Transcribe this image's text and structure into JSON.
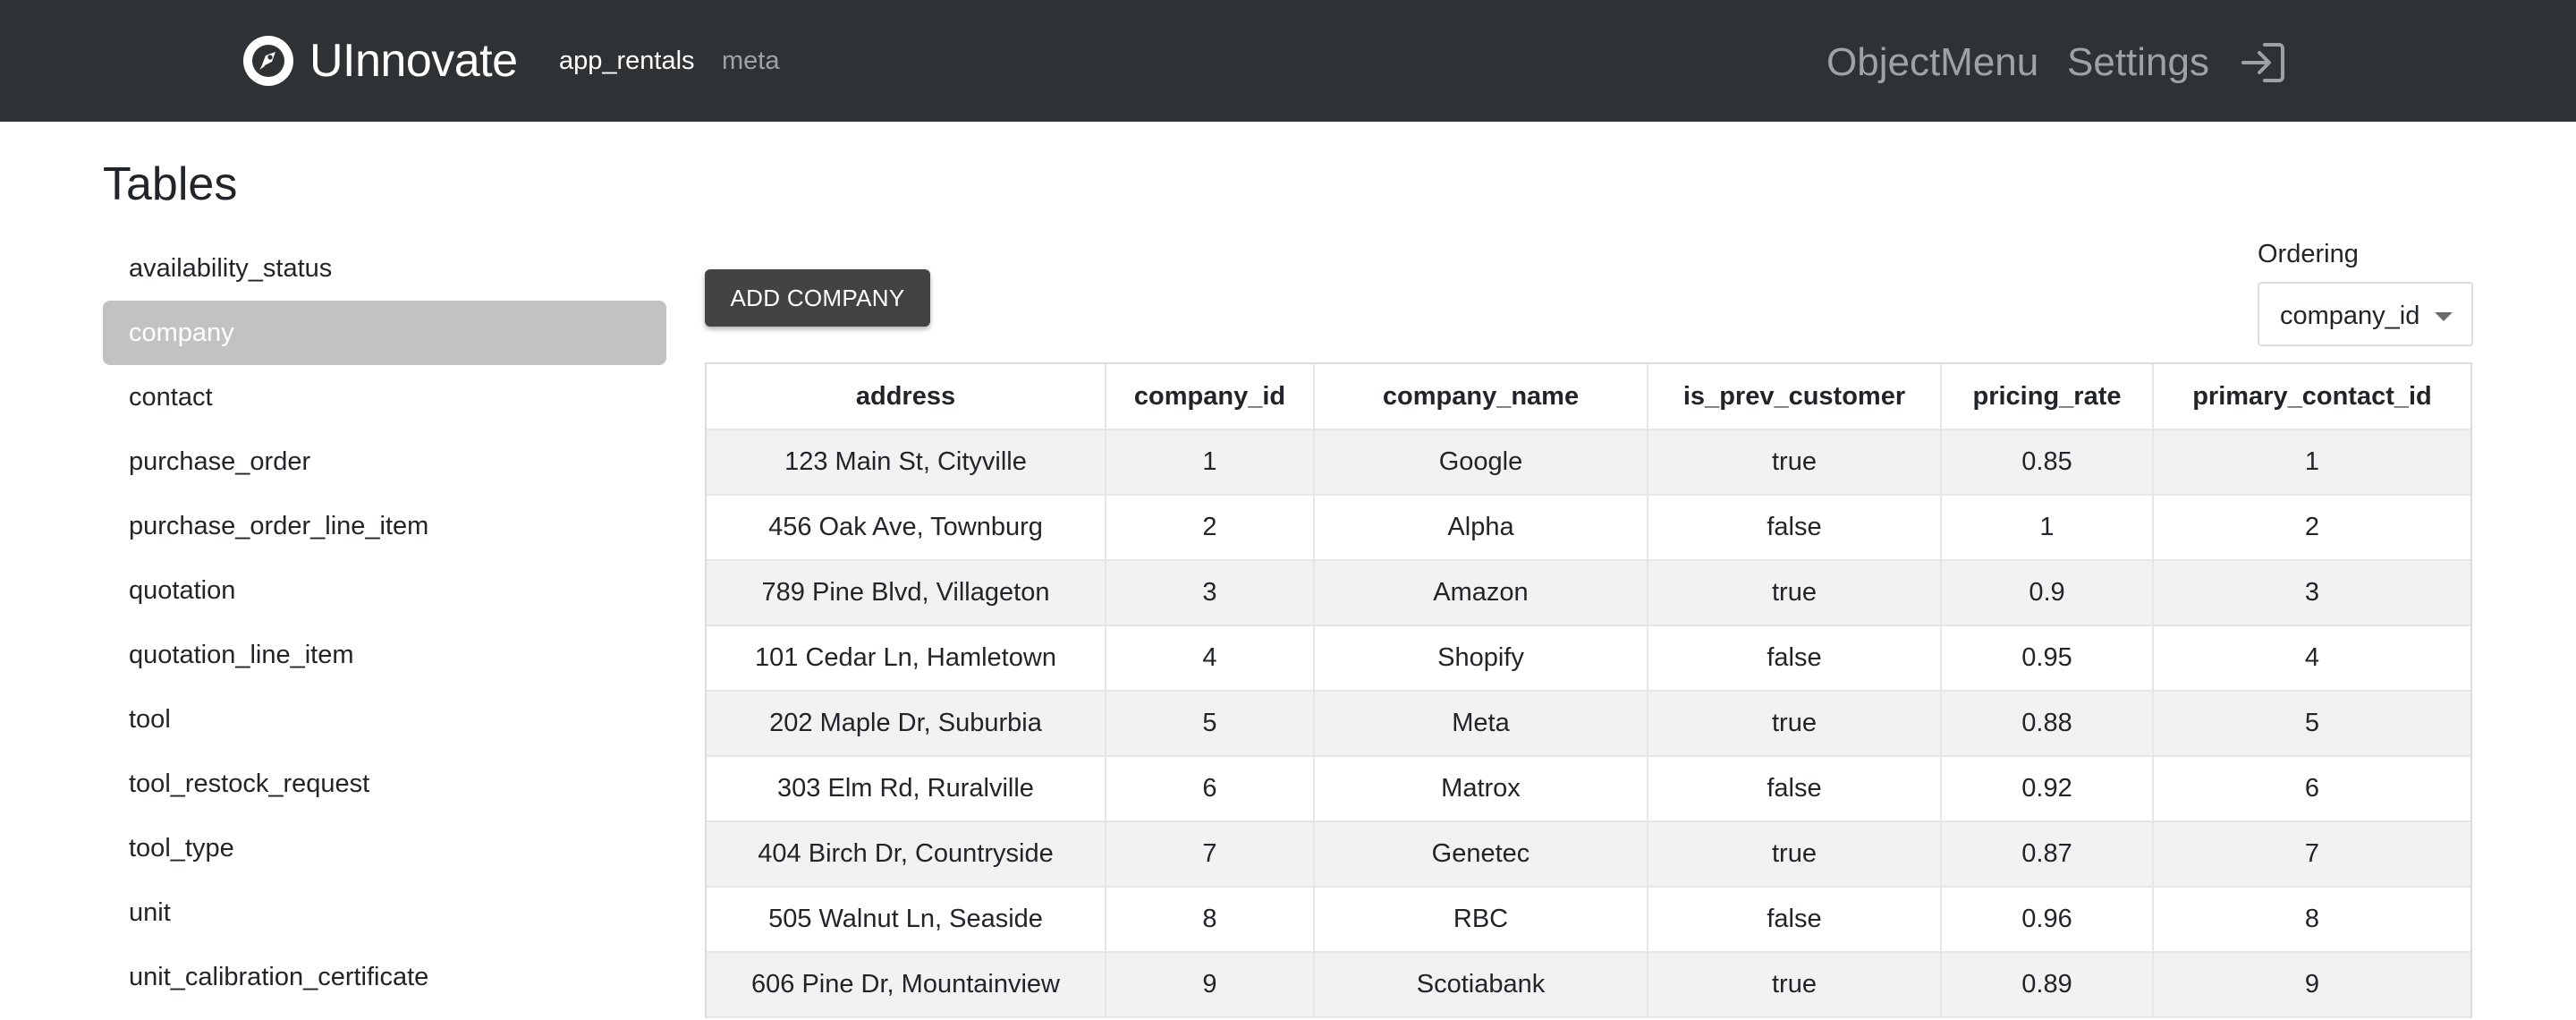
{
  "navbar": {
    "brand": "UInnovate",
    "links": [
      "app_rentals",
      "meta"
    ],
    "right_links": [
      "ObjectMenu",
      "Settings"
    ],
    "logout_icon": "logout-icon",
    "logo_icon": "rocket-logo-icon"
  },
  "page": {
    "title": "Tables"
  },
  "sidebar": {
    "items": [
      {
        "label": "availability_status",
        "selected": false
      },
      {
        "label": "company",
        "selected": true
      },
      {
        "label": "contact",
        "selected": false
      },
      {
        "label": "purchase_order",
        "selected": false
      },
      {
        "label": "purchase_order_line_item",
        "selected": false
      },
      {
        "label": "quotation",
        "selected": false
      },
      {
        "label": "quotation_line_item",
        "selected": false
      },
      {
        "label": "tool",
        "selected": false
      },
      {
        "label": "tool_restock_request",
        "selected": false
      },
      {
        "label": "tool_type",
        "selected": false
      },
      {
        "label": "unit",
        "selected": false
      },
      {
        "label": "unit_calibration_certificate",
        "selected": false
      }
    ]
  },
  "toolbar": {
    "add_label": "ADD COMPANY",
    "ordering_label": "Ordering",
    "ordering_value": "company_id"
  },
  "table": {
    "columns": [
      "address",
      "company_id",
      "company_name",
      "is_prev_customer",
      "pricing_rate",
      "primary_contact_id"
    ],
    "rows": [
      [
        "123 Main St, Cityville",
        "1",
        "Google",
        "true",
        "0.85",
        "1"
      ],
      [
        "456 Oak Ave, Townburg",
        "2",
        "Alpha",
        "false",
        "1",
        "2"
      ],
      [
        "789 Pine Blvd, Villageton",
        "3",
        "Amazon",
        "true",
        "0.9",
        "3"
      ],
      [
        "101 Cedar Ln, Hamletown",
        "4",
        "Shopify",
        "false",
        "0.95",
        "4"
      ],
      [
        "202 Maple Dr, Suburbia",
        "5",
        "Meta",
        "true",
        "0.88",
        "5"
      ],
      [
        "303 Elm Rd, Ruralville",
        "6",
        "Matrox",
        "false",
        "0.92",
        "6"
      ],
      [
        "404 Birch Dr, Countryside",
        "7",
        "Genetec",
        "true",
        "0.87",
        "7"
      ],
      [
        "505 Walnut Ln, Seaside",
        "8",
        "RBC",
        "false",
        "0.96",
        "8"
      ],
      [
        "606 Pine Dr, Mountainview",
        "9",
        "Scotiabank",
        "true",
        "0.89",
        "9"
      ]
    ]
  },
  "colors": {
    "navbar_bg": "#2f3235",
    "selected_item_bg": "#c2c2c2",
    "button_bg": "#434343",
    "row_stripe": "#f2f2f2"
  }
}
